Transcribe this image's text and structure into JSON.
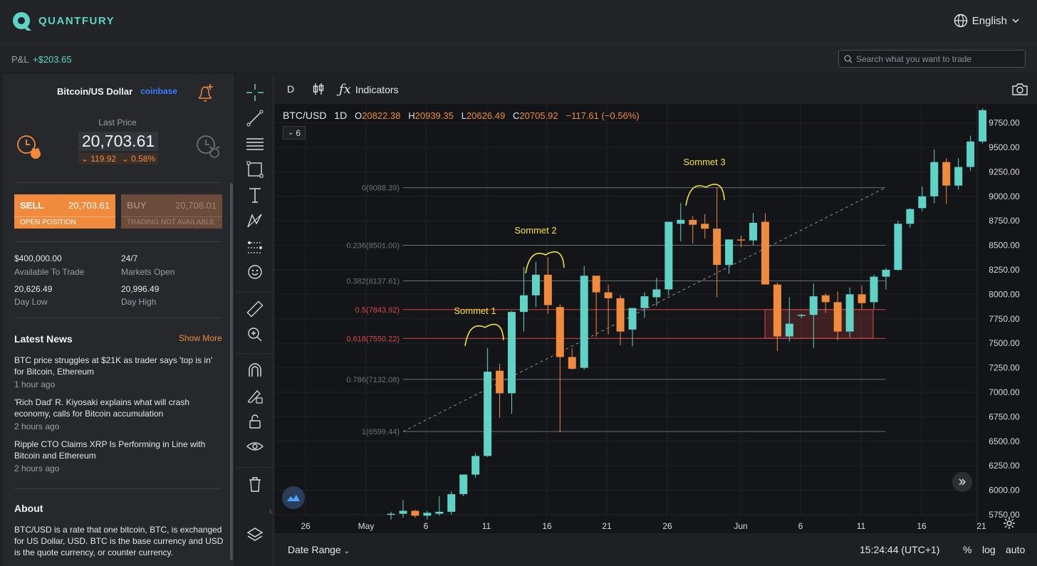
{
  "header": {
    "brand": "QUANTFURY",
    "language": "English"
  },
  "pnl": {
    "label": "P&L",
    "value": "+$203.65"
  },
  "search": {
    "placeholder": "Search what you want to trade"
  },
  "instrument": {
    "name": "Bitcoin/US Dollar",
    "exchange": "coinbase",
    "last_price_label": "Last Price",
    "last_price": "20,703.61",
    "change_abs": "119.92",
    "change_pct": "0.58%"
  },
  "trade": {
    "sell_label": "SELL",
    "sell_price": "20,703.61",
    "sell_sub": "OPEN POSITION",
    "buy_label": "BUY",
    "buy_price": "20,708.01",
    "buy_sub": "TRADING NOT AVAILABLE"
  },
  "stats": {
    "available_value": "$400,000.00",
    "available_label": "Available To Trade",
    "markets_value": "24/7",
    "markets_label": "Markets Open",
    "day_low_value": "20,626.49",
    "day_low_label": "Day Low",
    "day_high_value": "20,996.49",
    "day_high_label": "Day High"
  },
  "news": {
    "title": "Latest News",
    "show_more": "Show More",
    "items": [
      {
        "title": "BTC price struggles at $21K as trader says 'top is in' for Bitcoin, Ethereum",
        "time": "1 hour ago"
      },
      {
        "title": "'Rich Dad' R. Kiyosaki explains what will crash economy, calls for Bitcoin accumulation",
        "time": "2 hours ago"
      },
      {
        "title": "Ripple CTO Claims XRP Is Performing in Line with Bitcoin and Ethereum",
        "time": "2 hours ago"
      }
    ]
  },
  "about": {
    "title": "About",
    "text": "BTC/USD is a rate that one bitcoin, BTC, is exchanged for US Dollar, USD. BTC is the base currency and USD is the quote currency, or counter currency."
  },
  "chart_toolbar": {
    "interval": "D",
    "indicators": "Indicators"
  },
  "chart_footer": {
    "date_range": "Date Range",
    "time": "15:24:44 (UTC+1)",
    "percent": "%",
    "log": "log",
    "auto": "auto"
  },
  "legend": {
    "symbol": "BTC/USD",
    "interval": "1D",
    "o_label": "O",
    "o": "20822.38",
    "h_label": "H",
    "h": "20939.35",
    "l_label": "L",
    "l": "20626.49",
    "c_label": "C",
    "c": "20705.92",
    "change": "−117.61 (−0.56%)",
    "indicator_count": "6"
  },
  "colors": {
    "up": "#5fd3c5",
    "down": "#f08a3c",
    "accent": "#5fd3c5",
    "annotation": "#f5e13c",
    "fib_red": "#d84a4a"
  },
  "chart_data": {
    "type": "candlestick",
    "y_axis_labels": [
      "9750.00",
      "9500.00",
      "9250.00",
      "9000.00",
      "8750.00",
      "8500.00",
      "8250.00",
      "8000.00",
      "7750.00",
      "7500.00",
      "7250.00",
      "7000.00",
      "6750.00",
      "6500.00",
      "6250.00",
      "6000.00",
      "5750.00"
    ],
    "x_axis_labels": [
      "26",
      "May",
      "6",
      "11",
      "16",
      "21",
      "26",
      "Jun",
      "6",
      "11",
      "16",
      "21"
    ],
    "ylim": [
      5750,
      9750
    ],
    "candles": [
      {
        "o": 5750,
        "h": 5780,
        "l": 5700,
        "c": 5760
      },
      {
        "o": 5760,
        "h": 5900,
        "l": 5720,
        "c": 5790
      },
      {
        "o": 5790,
        "h": 5800,
        "l": 5720,
        "c": 5740
      },
      {
        "o": 5740,
        "h": 5790,
        "l": 5700,
        "c": 5770
      },
      {
        "o": 5760,
        "h": 5940,
        "l": 5740,
        "c": 5780
      },
      {
        "o": 5780,
        "h": 5990,
        "l": 5750,
        "c": 5960
      },
      {
        "o": 5960,
        "h": 6160,
        "l": 5940,
        "c": 6160
      },
      {
        "o": 6160,
        "h": 6380,
        "l": 6130,
        "c": 6350
      },
      {
        "o": 6350,
        "h": 7450,
        "l": 6340,
        "c": 7210
      },
      {
        "o": 7220,
        "h": 7290,
        "l": 6740,
        "c": 6990
      },
      {
        "o": 6990,
        "h": 7830,
        "l": 6780,
        "c": 7820
      },
      {
        "o": 7820,
        "h": 8280,
        "l": 7620,
        "c": 7990
      },
      {
        "o": 7990,
        "h": 8330,
        "l": 7870,
        "c": 8200
      },
      {
        "o": 8200,
        "h": 8380,
        "l": 7800,
        "c": 7890
      },
      {
        "o": 7870,
        "h": 7900,
        "l": 6590,
        "c": 7360
      },
      {
        "o": 7360,
        "h": 7450,
        "l": 7230,
        "c": 7240
      },
      {
        "o": 7250,
        "h": 8290,
        "l": 7230,
        "c": 8190
      },
      {
        "o": 8190,
        "h": 8190,
        "l": 7570,
        "c": 8020
      },
      {
        "o": 8020,
        "h": 8100,
        "l": 7590,
        "c": 7960
      },
      {
        "o": 7960,
        "h": 7990,
        "l": 7480,
        "c": 7620
      },
      {
        "o": 7640,
        "h": 7850,
        "l": 7470,
        "c": 7860
      },
      {
        "o": 7860,
        "h": 8020,
        "l": 7760,
        "c": 7980
      },
      {
        "o": 7970,
        "h": 8170,
        "l": 7880,
        "c": 8050
      },
      {
        "o": 8050,
        "h": 8740,
        "l": 7990,
        "c": 8740
      },
      {
        "o": 8720,
        "h": 8930,
        "l": 8540,
        "c": 8760
      },
      {
        "o": 8760,
        "h": 8800,
        "l": 8520,
        "c": 8710
      },
      {
        "o": 8720,
        "h": 8820,
        "l": 8570,
        "c": 8670
      },
      {
        "o": 8670,
        "h": 9090,
        "l": 7970,
        "c": 8300
      },
      {
        "o": 8300,
        "h": 8560,
        "l": 8210,
        "c": 8560
      },
      {
        "o": 8560,
        "h": 8600,
        "l": 8480,
        "c": 8550
      },
      {
        "o": 8550,
        "h": 8830,
        "l": 8500,
        "c": 8730
      },
      {
        "o": 8740,
        "h": 8830,
        "l": 8110,
        "c": 8100
      },
      {
        "o": 8100,
        "h": 8120,
        "l": 7420,
        "c": 7570
      },
      {
        "o": 7570,
        "h": 7970,
        "l": 7520,
        "c": 7700
      },
      {
        "o": 7780,
        "h": 7800,
        "l": 7760,
        "c": 7790
      },
      {
        "o": 7790,
        "h": 8110,
        "l": 7450,
        "c": 7980
      },
      {
        "o": 7990,
        "h": 8010,
        "l": 7810,
        "c": 7920
      },
      {
        "o": 7920,
        "h": 8030,
        "l": 7530,
        "c": 7620
      },
      {
        "o": 7620,
        "h": 8070,
        "l": 7560,
        "c": 8000
      },
      {
        "o": 8000,
        "h": 8090,
        "l": 7850,
        "c": 7910
      },
      {
        "o": 7920,
        "h": 8200,
        "l": 7850,
        "c": 8180
      },
      {
        "o": 8180,
        "h": 8270,
        "l": 8050,
        "c": 8250
      },
      {
        "o": 8250,
        "h": 8750,
        "l": 8240,
        "c": 8720
      },
      {
        "o": 8720,
        "h": 8880,
        "l": 8680,
        "c": 8870
      },
      {
        "o": 8880,
        "h": 9100,
        "l": 8850,
        "c": 9000
      },
      {
        "o": 9000,
        "h": 9480,
        "l": 8930,
        "c": 9350
      },
      {
        "o": 9350,
        "h": 9390,
        "l": 8920,
        "c": 9110
      },
      {
        "o": 9110,
        "h": 9390,
        "l": 9070,
        "c": 9300
      },
      {
        "o": 9300,
        "h": 9620,
        "l": 9260,
        "c": 9560
      },
      {
        "o": 9560,
        "h": 9900,
        "l": 9540,
        "c": 9880
      }
    ],
    "fib_levels": [
      {
        "label": "0(9088.39)",
        "value": 9088.39,
        "highlight": false
      },
      {
        "label": "0.236(8501.00)",
        "value": 8501.0,
        "highlight": false
      },
      {
        "label": "0.382(8137.61)",
        "value": 8137.61,
        "highlight": false
      },
      {
        "label": "0.5(7843.92)",
        "value": 7843.92,
        "highlight": true
      },
      {
        "label": "0.618(7550.22)",
        "value": 7550.22,
        "highlight": true
      },
      {
        "label": "0.786(7132.08)",
        "value": 7132.08,
        "highlight": false
      },
      {
        "label": "1(6599.44)",
        "value": 6599.44,
        "highlight": false
      }
    ],
    "annotations": [
      "Sommet 1",
      "Sommet 2",
      "Sommet 3"
    ]
  }
}
